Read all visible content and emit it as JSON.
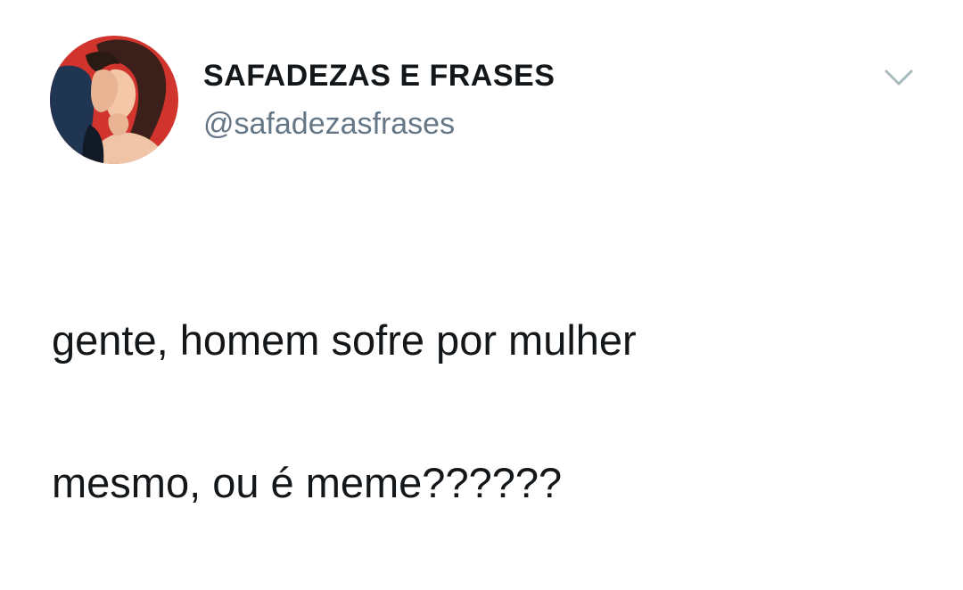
{
  "tweet": {
    "display_name": "SAFADEZAS E FRASES",
    "handle": "@safadezasfrases",
    "text_line1": "gente, homem sofre por mulher",
    "text_line2": "mesmo, ou é meme??????",
    "menu_icon": "chevron-down-icon",
    "avatar_icon": "illustrated-couple-avatar"
  },
  "colors": {
    "background": "#ffffff",
    "text": "#14171a",
    "secondary_text": "#657786",
    "avatar_background": "#d0342c",
    "caret": "#aab8c2"
  }
}
